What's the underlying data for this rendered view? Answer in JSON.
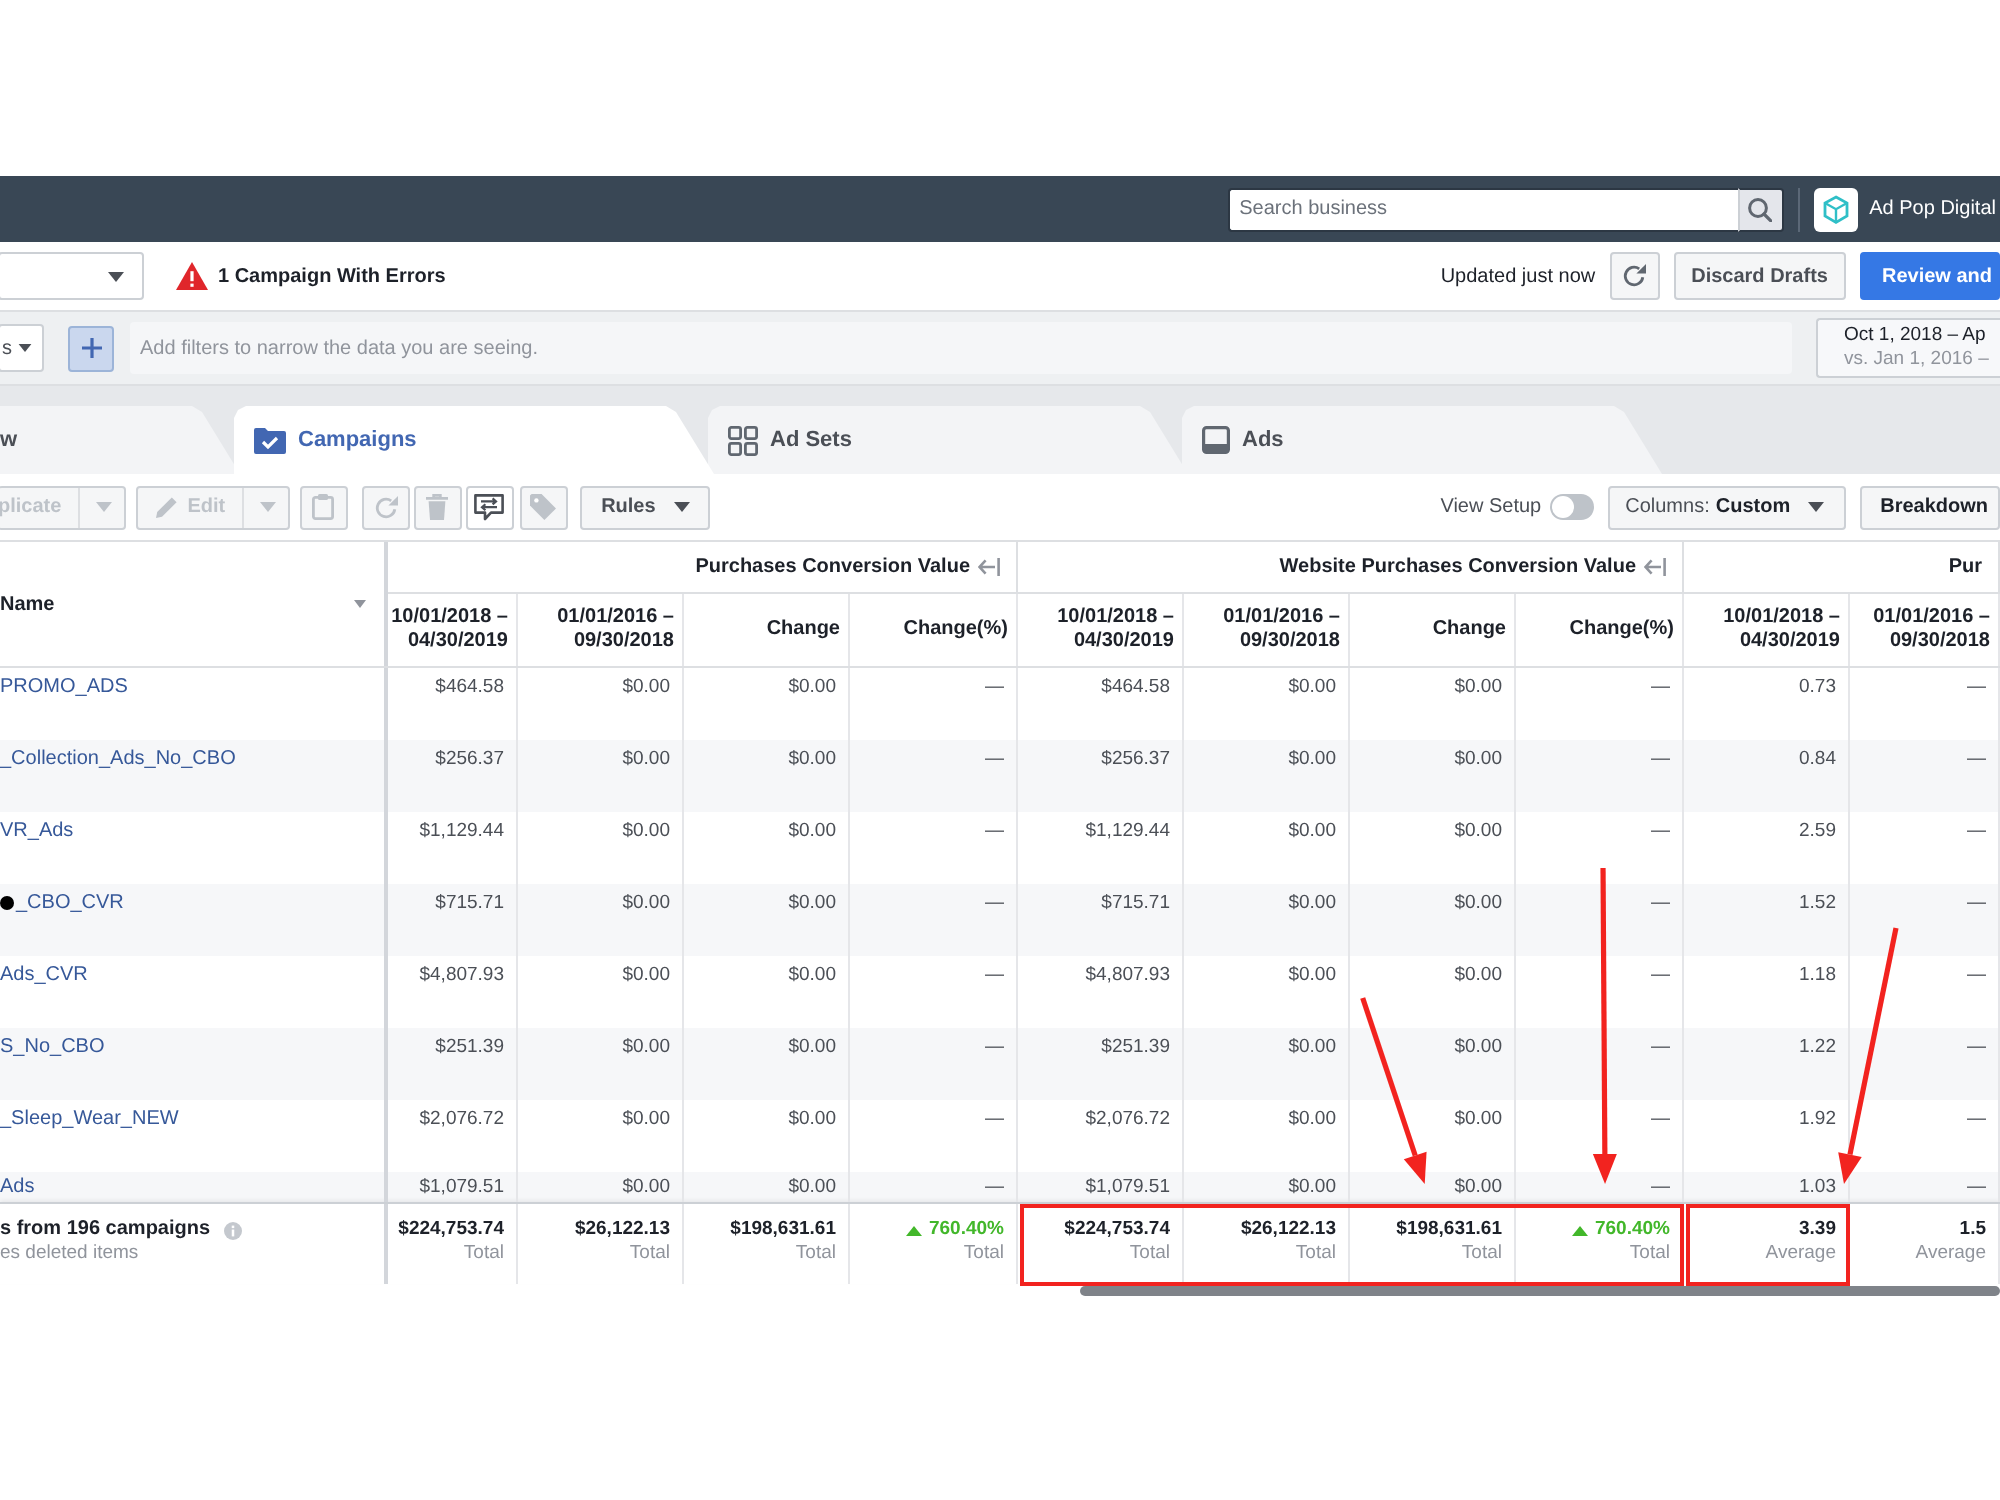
{
  "top_bar": {
    "search": {
      "placeholder": "Search business"
    },
    "account": "Ad Pop Digital"
  },
  "action_bar": {
    "errors": "1 Campaign With Errors",
    "status": "Updated just now",
    "buttons": [
      {
        "label": "Discard Drafts",
        "kind": "secondary"
      },
      {
        "label": "Review and",
        "kind": "primary"
      }
    ]
  },
  "filter_bar": {
    "dropdown": "s",
    "placeholder": "Add filters to narrow the data you are seeing.",
    "date_range": {
      "current": "Oct 1, 2018 – Ap",
      "comparison": "vs. Jan 1, 2016 –"
    }
  },
  "tabs": [
    {
      "label": "w",
      "selected": false
    },
    {
      "label": "Campaigns",
      "selected": true
    },
    {
      "label": "Ad Sets",
      "selected": false
    },
    {
      "label": "Ads",
      "selected": false
    }
  ],
  "toolbar": {
    "actions": [
      {
        "kind": "split",
        "label": "plicate",
        "disabled": true
      },
      {
        "kind": "split",
        "label": "Edit",
        "disabled": true
      },
      {
        "kind": "icon",
        "disabled": true
      },
      {
        "kind": "icon",
        "disabled": true
      },
      {
        "kind": "icon",
        "disabled": true
      },
      {
        "kind": "icon",
        "disabled": false
      },
      {
        "kind": "icon",
        "disabled": true
      },
      {
        "kind": "menu",
        "label": "Rules",
        "disabled": false
      }
    ],
    "view_setup": {
      "label": "View Setup",
      "on": false
    },
    "columns": {
      "label": "Columns:",
      "value": "Custom"
    },
    "breakdown": "Breakdown"
  },
  "table": {
    "name_header": "Name",
    "groups": [
      {
        "title": "Purchases Conversion Value",
        "collapse": true,
        "columns": [
          "10/01/2018 – 04/30/2019",
          "01/01/2016 – 09/30/2018",
          "Change",
          "Change(%)"
        ]
      },
      {
        "title": "Website Purchases Conversion Value",
        "collapse": true,
        "columns": [
          "10/01/2018 – 04/30/2019",
          "01/01/2016 – 09/30/2018",
          "Change",
          "Change(%)"
        ]
      },
      {
        "title": "Pur",
        "collapse": false,
        "columns": [
          "10/01/2018 – 04/30/2019",
          "01/01/2016 – 09/30/2018"
        ]
      }
    ],
    "rows": [
      {
        "name": "PROMO_ADS",
        "lead_dot": false,
        "cells": [
          "$464.58",
          "$0.00",
          "$0.00",
          "—",
          "$464.58",
          "$0.00",
          "$0.00",
          "—",
          "0.73",
          "—"
        ]
      },
      {
        "name": "_Collection_Ads_No_CBO",
        "lead_dot": false,
        "cells": [
          "$256.37",
          "$0.00",
          "$0.00",
          "—",
          "$256.37",
          "$0.00",
          "$0.00",
          "—",
          "0.84",
          "—"
        ]
      },
      {
        "name": "VR_Ads",
        "lead_dot": false,
        "cells": [
          "$1,129.44",
          "$0.00",
          "$0.00",
          "—",
          "$1,129.44",
          "$0.00",
          "$0.00",
          "—",
          "2.59",
          "—"
        ]
      },
      {
        "name": "_CBO_CVR",
        "lead_dot": true,
        "cells": [
          "$715.71",
          "$0.00",
          "$0.00",
          "—",
          "$715.71",
          "$0.00",
          "$0.00",
          "—",
          "1.52",
          "—"
        ]
      },
      {
        "name": "Ads_CVR",
        "lead_dot": false,
        "cells": [
          "$4,807.93",
          "$0.00",
          "$0.00",
          "—",
          "$4,807.93",
          "$0.00",
          "$0.00",
          "—",
          "1.18",
          "—"
        ]
      },
      {
        "name": "S_No_CBO",
        "lead_dot": false,
        "cells": [
          "$251.39",
          "$0.00",
          "$0.00",
          "—",
          "$251.39",
          "$0.00",
          "$0.00",
          "—",
          "1.22",
          "—"
        ]
      },
      {
        "name": "_Sleep_Wear_NEW",
        "lead_dot": false,
        "cells": [
          "$2,076.72",
          "$0.00",
          "$0.00",
          "—",
          "$2,076.72",
          "$0.00",
          "$0.00",
          "—",
          "1.92",
          "—"
        ]
      },
      {
        "name": "Ads",
        "lead_dot": false,
        "cells": [
          "$1,079.51",
          "$0.00",
          "$0.00",
          "—",
          "$1,079.51",
          "$0.00",
          "$0.00",
          "—",
          "1.03",
          "—"
        ]
      }
    ]
  },
  "totals": {
    "label": "s from 196 campaigns",
    "note": "es deleted items",
    "cells": [
      {
        "value": "$224,753.74",
        "caption": "Total",
        "trend_up": false,
        "highlighted": false,
        "arrow": false
      },
      {
        "value": "$26,122.13",
        "caption": "Total",
        "trend_up": false,
        "highlighted": false,
        "arrow": false
      },
      {
        "value": "$198,631.61",
        "caption": "Total",
        "trend_up": false,
        "highlighted": false,
        "arrow": false
      },
      {
        "value": "760.40%",
        "caption": "Total",
        "trend_up": true,
        "highlighted": false,
        "arrow": false
      },
      {
        "value": "$224,753.74",
        "caption": "Total",
        "trend_up": false,
        "highlighted": true,
        "arrow": false
      },
      {
        "value": "$26,122.13",
        "caption": "Total",
        "trend_up": false,
        "highlighted": true,
        "arrow": false
      },
      {
        "value": "$198,631.61",
        "caption": "Total",
        "trend_up": false,
        "highlighted": true,
        "arrow": true
      },
      {
        "value": "760.40%",
        "caption": "Total",
        "trend_up": true,
        "highlighted": true,
        "arrow": true
      },
      {
        "value": "3.39",
        "caption": "Average",
        "trend_up": false,
        "highlighted": true,
        "arrow": true
      },
      {
        "value": "1.5",
        "caption": "Average",
        "trend_up": false,
        "highlighted": false,
        "arrow": false
      }
    ]
  }
}
